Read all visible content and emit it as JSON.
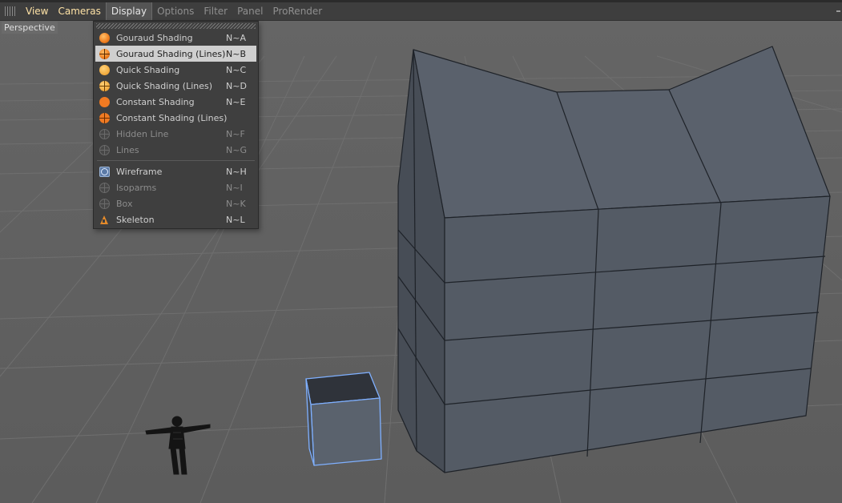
{
  "menubar": {
    "items": [
      {
        "label": "View",
        "state": "highlight"
      },
      {
        "label": "Cameras",
        "state": "highlight"
      },
      {
        "label": "Display",
        "state": "active"
      },
      {
        "label": "Options",
        "state": "dim"
      },
      {
        "label": "Filter",
        "state": "dim"
      },
      {
        "label": "Panel",
        "state": "dim"
      },
      {
        "label": "ProRender",
        "state": "dim"
      }
    ]
  },
  "viewport": {
    "label": "Perspective"
  },
  "display_menu": {
    "items": [
      {
        "label": "Gouraud Shading",
        "shortcut": "N~A",
        "icon": "gouraud-shading-icon"
      },
      {
        "label": "Gouraud Shading (Lines)",
        "shortcut": "N~B",
        "icon": "gouraud-shading-lines-icon",
        "selected": true
      },
      {
        "label": "Quick Shading",
        "shortcut": "N~C",
        "icon": "quick-shading-icon"
      },
      {
        "label": "Quick Shading (Lines)",
        "shortcut": "N~D",
        "icon": "quick-shading-lines-icon"
      },
      {
        "label": "Constant Shading",
        "shortcut": "N~E",
        "icon": "constant-shading-icon"
      },
      {
        "label": "Constant Shading (Lines)",
        "shortcut": "N~F",
        "icon": "constant-shading-lines-icon"
      },
      {
        "label": "Hidden Line",
        "shortcut": "N~F",
        "icon": "hidden-line-icon",
        "disabled": true
      },
      {
        "label": "Lines",
        "shortcut": "N~G",
        "icon": "lines-icon",
        "disabled": true
      },
      {
        "label": "Wireframe",
        "shortcut": "N~H",
        "icon": "wireframe-icon"
      },
      {
        "label": "Isoparms",
        "shortcut": "N~I",
        "icon": "isoparms-icon",
        "disabled": true
      },
      {
        "label": "Box",
        "shortcut": "N~K",
        "icon": "box-icon",
        "disabled": true
      },
      {
        "label": "Skeleton",
        "shortcut": "N~L",
        "icon": "skeleton-icon"
      }
    ]
  },
  "colors": {
    "menubar_bg": "#3e3e3e",
    "viewport_bg": "#5a5a5a",
    "object_fill": "#5a626d",
    "selection_outline": "#7fb0ff",
    "accent_orange": "#ef7d1e"
  }
}
